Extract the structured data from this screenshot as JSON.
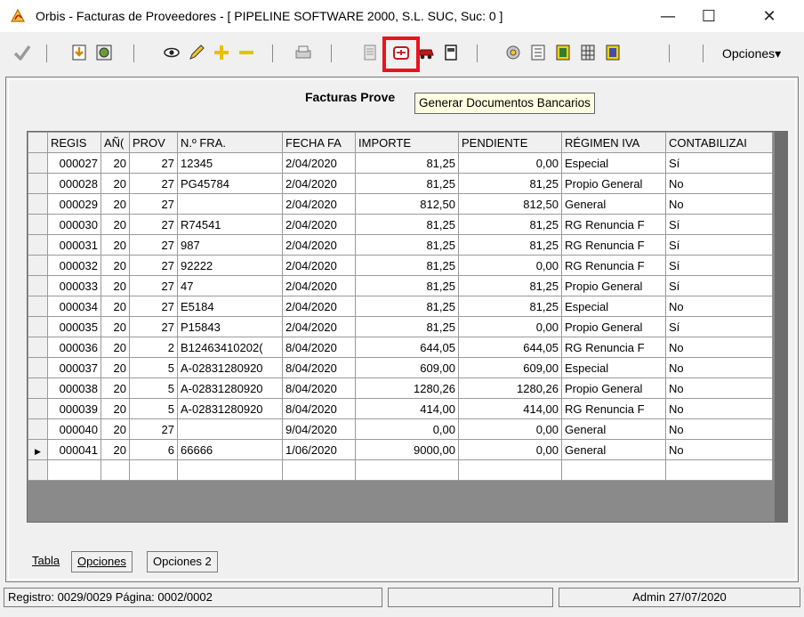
{
  "window": {
    "title": "Orbis - Facturas de Proveedores - [ PIPELINE SOFTWARE 2000, S.L. SUC,  Suc: 0 ]",
    "min_glyph": "—",
    "max_glyph": "☐",
    "close_glyph": "✕"
  },
  "toolbar": {
    "opciones_label": "Opciones▾",
    "highlight_color": "#e8141e",
    "icons": [
      "check-icon",
      "import-icon",
      "filter-icon",
      "view-icon",
      "edit-icon",
      "add-icon",
      "remove-icon",
      "print-icon",
      "print-preview-icon",
      "bank-document-icon",
      "car-icon",
      "document-icon",
      "settings-icon",
      "list-icon",
      "report-yellow-icon",
      "report-grid-icon",
      "report-blue-icon"
    ]
  },
  "panel": {
    "title": "Facturas Prove",
    "tooltip": "Generar Documentos Bancarios"
  },
  "grid": {
    "columns": [
      "REGIS",
      "AÑ(",
      "PROV",
      "N.º FRA.",
      "FECHA FA",
      "IMPORTE",
      "PENDIENTE",
      "RÉGIMEN IVA",
      "CONTABILIZAI"
    ],
    "rows": [
      [
        "000027",
        "20",
        "27",
        "12345",
        "2/04/2020",
        "81,25",
        "0,00",
        "Especial",
        "Sí"
      ],
      [
        "000028",
        "20",
        "27",
        "PG45784",
        "2/04/2020",
        "81,25",
        "81,25",
        "Propio General",
        "No"
      ],
      [
        "000029",
        "20",
        "27",
        "",
        "2/04/2020",
        "812,50",
        "812,50",
        "General",
        "No"
      ],
      [
        "000030",
        "20",
        "27",
        "R74541",
        "2/04/2020",
        "81,25",
        "81,25",
        "RG Renuncia F",
        "Sí"
      ],
      [
        "000031",
        "20",
        "27",
        "987",
        "2/04/2020",
        "81,25",
        "81,25",
        "RG Renuncia F",
        "Sí"
      ],
      [
        "000032",
        "20",
        "27",
        "92222",
        "2/04/2020",
        "81,25",
        "0,00",
        "RG Renuncia F",
        "Sí"
      ],
      [
        "000033",
        "20",
        "27",
        "47",
        "2/04/2020",
        "81,25",
        "81,25",
        "Propio General",
        "Sí"
      ],
      [
        "000034",
        "20",
        "27",
        "E5184",
        "2/04/2020",
        "81,25",
        "81,25",
        "Especial",
        "No"
      ],
      [
        "000035",
        "20",
        "27",
        "P15843",
        "2/04/2020",
        "81,25",
        "0,00",
        "Propio General",
        "Sí"
      ],
      [
        "000036",
        "20",
        "2",
        "B12463410202(",
        "8/04/2020",
        "644,05",
        "644,05",
        "RG Renuncia F",
        "No"
      ],
      [
        "000037",
        "20",
        "5",
        "A-02831280920",
        "8/04/2020",
        "609,00",
        "609,00",
        "Especial",
        "No"
      ],
      [
        "000038",
        "20",
        "5",
        "A-02831280920",
        "8/04/2020",
        "1280,26",
        "1280,26",
        "Propio General",
        "No"
      ],
      [
        "000039",
        "20",
        "5",
        "A-02831280920",
        "8/04/2020",
        "414,00",
        "414,00",
        "RG Renuncia F",
        "No"
      ],
      [
        "000040",
        "20",
        "27",
        "",
        "9/04/2020",
        "0,00",
        "0,00",
        "General",
        "No"
      ],
      [
        "000041",
        "20",
        "6",
        "66666",
        "1/06/2020",
        "9000,00",
        "0,00",
        "General",
        "No"
      ]
    ],
    "current_row_marker": "▶"
  },
  "tabs": {
    "tabla": "Tabla",
    "opciones": "Opciones",
    "opciones2": "Opciones 2"
  },
  "status": {
    "left": "Registro: 0029/0029  Página: 0002/0002",
    "right": "Admin 27/07/2020"
  }
}
